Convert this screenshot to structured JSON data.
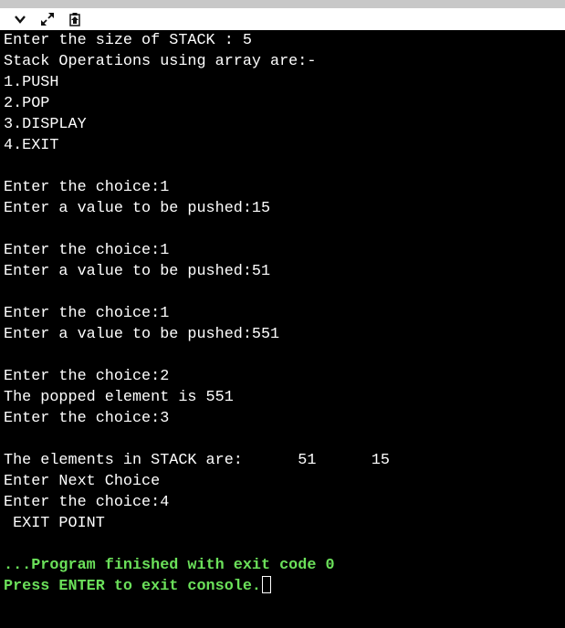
{
  "toolbar": {
    "buttons": [
      "chevron-down-icon",
      "expand-icon",
      "clipboard-paste-icon"
    ]
  },
  "console": {
    "lines": [
      "Enter the size of STACK : 5",
      "Stack Operations using array are:-",
      "1.PUSH",
      "2.POP",
      "3.DISPLAY",
      "4.EXIT",
      "",
      "Enter the choice:1",
      "Enter a value to be pushed:15",
      "",
      "Enter the choice:1",
      "Enter a value to be pushed:51",
      "",
      "Enter the choice:1",
      "Enter a value to be pushed:551",
      "",
      "Enter the choice:2",
      "The popped element is 551",
      "Enter the choice:3",
      "",
      "The elements in STACK are:      51      15",
      "Enter Next Choice",
      "Enter the choice:4",
      " EXIT POINT",
      "",
      "...Program finished with exit code 0",
      "Press ENTER to exit console."
    ],
    "text_color": "#ffffff",
    "status_color": "#6be05a",
    "background": "#000000"
  }
}
